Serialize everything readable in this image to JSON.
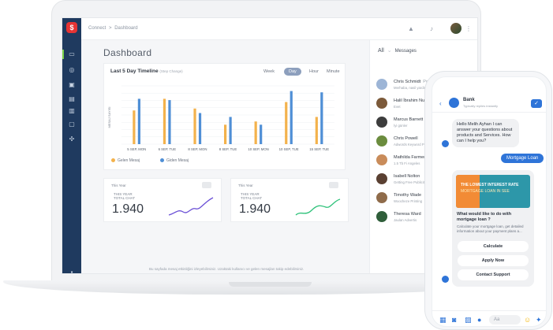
{
  "topbar": {
    "crumb_root": "Connect",
    "crumb_sep": ">",
    "crumb_page": "Dashboard"
  },
  "page_title": "Dashboard",
  "timeline": {
    "title": "Last 5 Day  Timeline",
    "hint": "(Step Change)",
    "tabs": [
      "Week",
      "Day",
      "Hour",
      "Minute"
    ],
    "active_tab": "Day",
    "ylabel": "MESAJ SAYISI",
    "legend": [
      "Gelen Mesaj",
      "Giden Mesaj"
    ]
  },
  "chart_data": {
    "type": "bar",
    "categories": [
      "5 SEP, MON",
      "6 SEP, TUE",
      "8 SEP, MON",
      "8 SEP, TUE",
      "10 SEP, MON",
      "10 SEP, TUE",
      "15 SEP, TUE"
    ],
    "series": [
      {
        "name": "Gelen Mesaj",
        "color": "#f3b24c",
        "values": [
          52,
          70,
          55,
          30,
          35,
          65,
          42
        ]
      },
      {
        "name": "Giden Mesaj",
        "color": "#4f8fd6",
        "values": [
          70,
          68,
          48,
          42,
          30,
          82,
          80
        ]
      }
    ],
    "ylim": [
      0,
      90
    ],
    "grid": true
  },
  "stats": [
    {
      "period": "This Year",
      "label1": "THIS YEAR",
      "label2": "TOTAL CHAT",
      "value": "1.940",
      "color": "#6a4fd6"
    },
    {
      "period": "This Year",
      "label1": "THIS YEAR",
      "label2": "TOTAL CHAT",
      "value": "1.940",
      "color": "#2ec27a"
    }
  ],
  "footnote": "Bu sayfada mesaj etkinliğini izleyebilirsiniz. Uzaktaki kullanıcı ve gelen mesajları takip edebilirsiniz.",
  "messages": {
    "filter": "All",
    "title": "Messages",
    "items": [
      {
        "name": "Chris Schmidt",
        "company": "Portakal Agac",
        "sub": "Merhaba, nasil yardimci olabilirim"
      },
      {
        "name": "Halil İbrahim Nuroğ",
        "sub": "Evet"
      },
      {
        "name": "Marcus Barnett",
        "sub": "İyi günler"
      },
      {
        "name": "Chris Powell",
        "sub": "Adwords Keyword Planner"
      },
      {
        "name": "Mathilda Farmer",
        "sub": "1.5 Tb Fi Angeles"
      },
      {
        "name": "Isabell Nolton",
        "sub": "Getting Free Publicity"
      },
      {
        "name": "Timothy Wade",
        "sub": "Woocheze Printing"
      },
      {
        "name": "Theresa Ward",
        "sub": "Jaulan Advertis"
      }
    ]
  },
  "phone": {
    "contact": "Bank",
    "status": "Typically replies instantly",
    "greeting": "Hello  Melih Ayhan I can answer your questions about products and Services. How can I help you?",
    "user_msg": "Mortgage Loan",
    "promo_line1": "THE LOWEST INTEREST RATE",
    "promo_line2": "MORTGAGE LOAN IN SEE",
    "card_title": "What would like to do with mortgage loan ?",
    "card_text": "Calculate your mortgage loan, get detailed information about your payment plans a...",
    "buttons": [
      "Calculate",
      "Apply Now",
      "Contact Support"
    ],
    "input_placeholder": "Aa"
  }
}
